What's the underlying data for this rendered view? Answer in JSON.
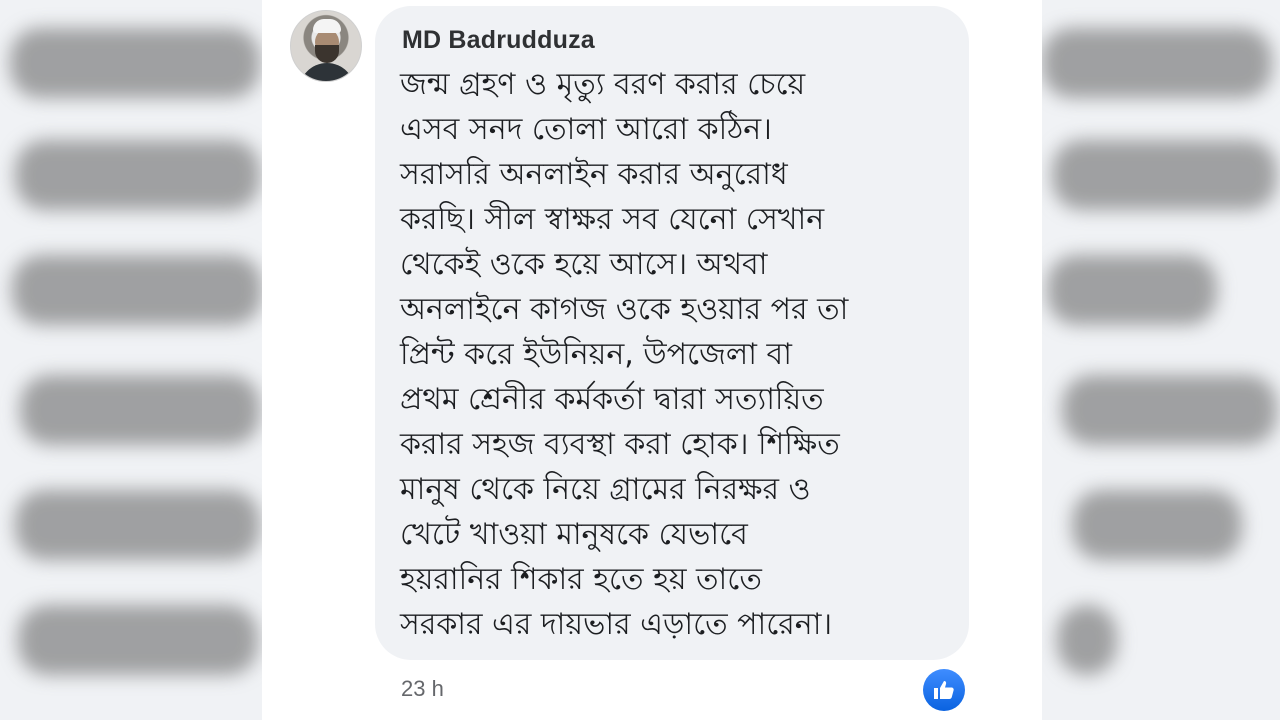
{
  "comment": {
    "author": "MD Badrudduza",
    "lines": [
      "জন্ম গ্রহণ ও মৃত্যু বরণ করার চেয়ে",
      "এসব সনদ তোলা আরো কঠিন।",
      "সরাসরি অনলাইন করার অনুরোধ",
      "করছি। সীল স্বাক্ষর সব যেনো সেখান",
      "থেকেই ওকে হয়ে আসে। অথবা",
      "অনলাইনে কাগজ ওকে হওয়ার পর তা",
      "প্রিন্ট করে ইউনিয়ন, উপজেলা বা",
      "প্রথম শ্রেনীর কর্মকর্তা দ্বারা সত্যায়িত",
      "করার সহজ ব্যবস্থা করা হোক। শিক্ষিত",
      "মানুষ থেকে নিয়ে গ্রামের নিরক্ষর ও",
      "খেটে খাওয়া মানুষকে যেভাবে",
      "হয়রানির শিকার হতে হয় তাতে",
      "সরকার এর দায়ভার এড়াতে পারেনা।"
    ],
    "timestamp": "23 h",
    "reaction_icon": "like-thumbs-up-icon"
  },
  "colors": {
    "bubble": "#f0f2f5",
    "like_blue": "#1877f2",
    "meta_text": "#65676b"
  }
}
